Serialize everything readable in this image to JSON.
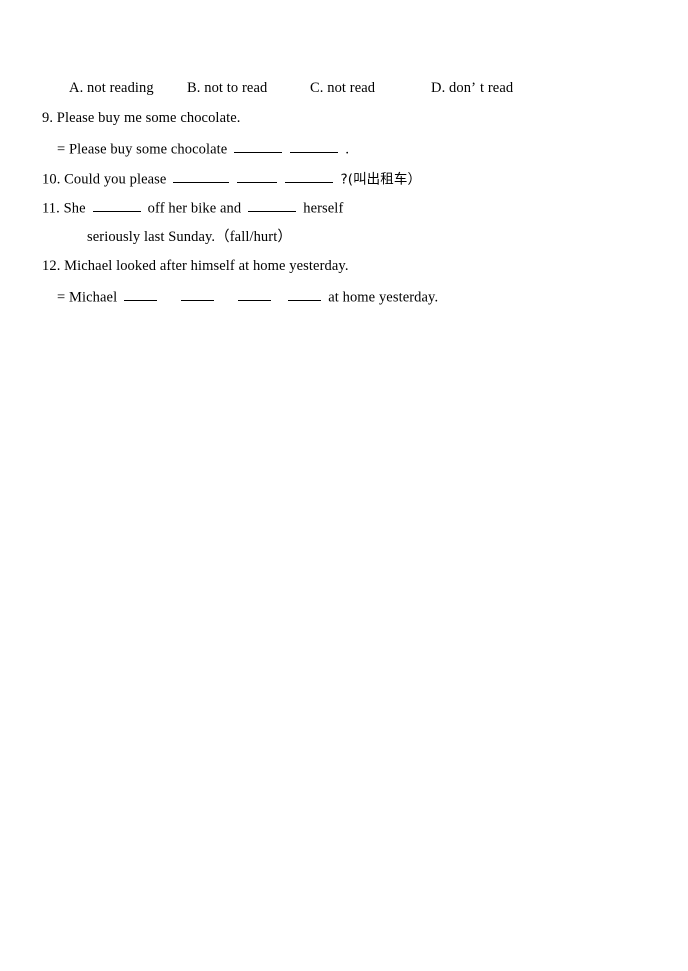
{
  "document": {
    "kind": "english-grammar-worksheet-page",
    "background_color": "#ffffff",
    "text_color": "#000000"
  },
  "options_row": {
    "label": "multiple-choice-options",
    "options": [
      {
        "key": "A",
        "text": "A. not reading"
      },
      {
        "key": "B",
        "text": "B. not to read"
      },
      {
        "key": "C",
        "text": "C. not read"
      },
      {
        "key": "D",
        "text_before_apostrophe": "D. don",
        "apostrophe": "’",
        "text_after_apostrophe": "t read"
      }
    ]
  },
  "questions": [
    {
      "number": "9",
      "prompt": "9. Please buy me some chocolate.",
      "answer_prefix": "= Please buy some chocolate",
      "answer_suffix": ".",
      "blanks": [
        "md",
        "md"
      ]
    },
    {
      "number": "10",
      "prompt_prefix": "10. Could you please",
      "prompt_suffix": "?(叫出租车）",
      "blanks": [
        "lg",
        "sm",
        "md"
      ]
    },
    {
      "number": "11",
      "prompt_part1": "11. She",
      "prompt_part2": "off her bike and",
      "prompt_part3": "herself",
      "second_line": "seriously last Sunday.（fall/hurt）",
      "blanks": [
        "md",
        "md"
      ]
    },
    {
      "number": "12",
      "prompt": "12. Michael looked after himself at home yesterday.",
      "answer_prefix": "= Michael",
      "answer_suffix": "at home yesterday.",
      "blanks": [
        "xs",
        "xs",
        "xs",
        "xs"
      ]
    }
  ]
}
